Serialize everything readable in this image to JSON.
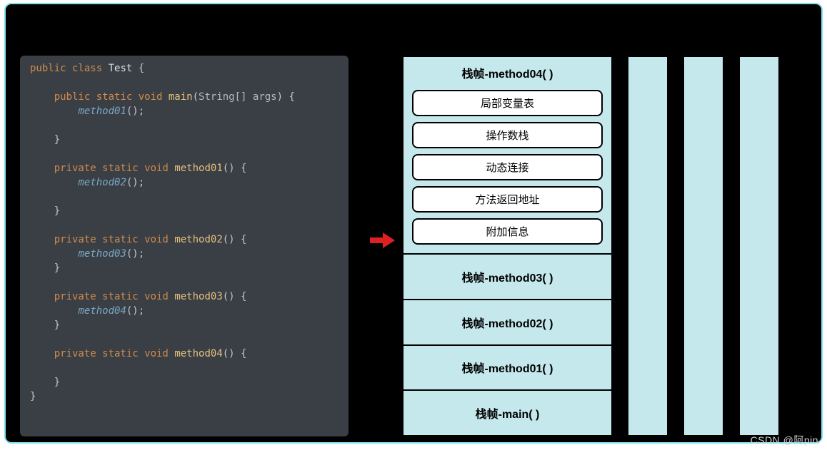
{
  "code": {
    "class_decl": {
      "mods": "public class",
      "name": "Test"
    },
    "main": {
      "mods": "public static void",
      "name": "main",
      "params": "String[] args",
      "call": "method01"
    },
    "methods": [
      {
        "mods": "private static void",
        "name": "method01",
        "call": "method02"
      },
      {
        "mods": "private static void",
        "name": "method02",
        "call": "method03"
      },
      {
        "mods": "private static void",
        "name": "method03",
        "call": "method04"
      },
      {
        "mods": "private static void",
        "name": "method04",
        "call": ""
      }
    ]
  },
  "stack": {
    "expanded_frame": {
      "title": "栈帧-method04( )",
      "parts": [
        "局部变量表",
        "操作数栈",
        "动态连接",
        "方法返回地址",
        "附加信息"
      ]
    },
    "frames": [
      "栈帧-method03( )",
      "栈帧-method02( )",
      "栈帧-method01( )",
      "栈帧-main( )"
    ]
  },
  "watermark": "CSDN @阿pin"
}
